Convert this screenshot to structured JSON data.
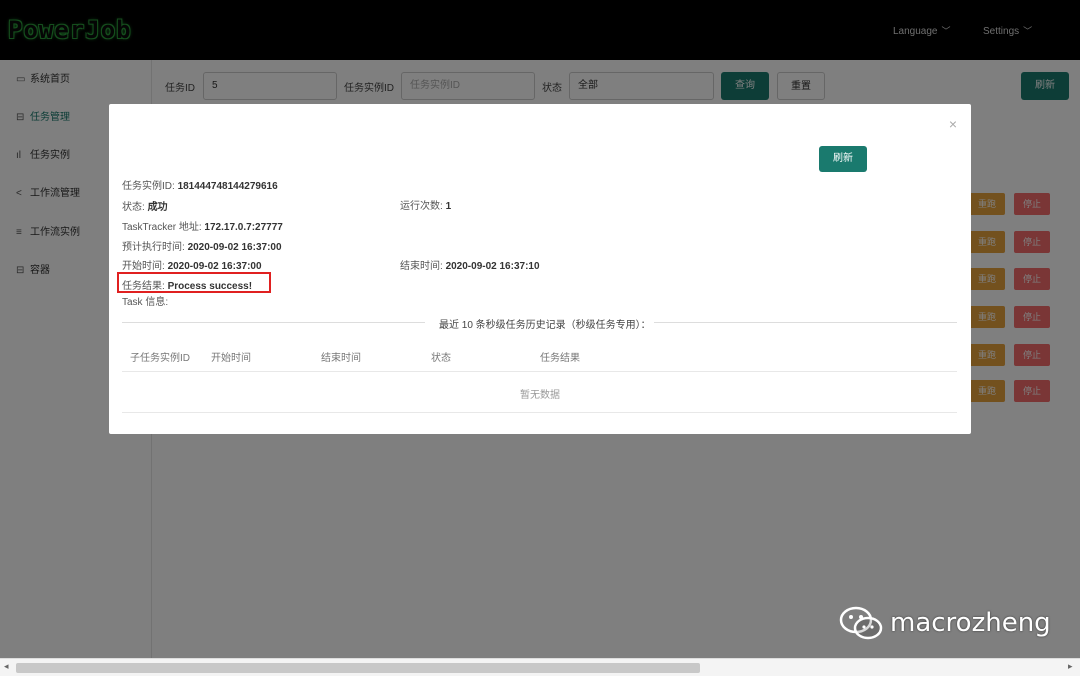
{
  "header": {
    "logo": "PowerJob",
    "language_label": "Language",
    "settings_label": "Settings"
  },
  "sidebar": {
    "items": [
      {
        "label": "系统首页",
        "icon": "monitor-icon"
      },
      {
        "label": "任务管理",
        "icon": "task-icon"
      },
      {
        "label": "任务实例",
        "icon": "bar-chart-icon"
      },
      {
        "label": "工作流管理",
        "icon": "share-icon"
      },
      {
        "label": "工作流实例",
        "icon": "sliders-icon"
      },
      {
        "label": "容器",
        "icon": "container-icon"
      }
    ],
    "active": "任务管理"
  },
  "filters": {
    "task_id_label": "任务ID",
    "task_id_value": "5",
    "instance_id_label": "任务实例ID",
    "instance_id_placeholder": "任务实例ID",
    "status_label": "状态",
    "status_value": "全部",
    "query_label": "查询",
    "reset_label": "重置",
    "refresh_label": "刷新"
  },
  "row_actions": {
    "retry_label": "重跑",
    "stop_label": "停止"
  },
  "modal": {
    "close": "×",
    "refresh_label": "刷新",
    "instance_id_label": "任务实例ID:",
    "instance_id_value": "181444748144279616",
    "status_label": "状态:",
    "status_value": "成功",
    "run_count_label": "运行次数:",
    "run_count_value": "1",
    "tracker_label": "TaskTracker 地址:",
    "tracker_value": "172.17.0.7:27777",
    "expected_time_label": "预计执行时间:",
    "expected_time_value": "2020-09-02 16:37:00",
    "start_time_label": "开始时间:",
    "start_time_value": "2020-09-02 16:37:00",
    "end_time_label": "结束时间:",
    "end_time_value": "2020-09-02 16:37:10",
    "result_label": "任务结果:",
    "result_value": "Process success!",
    "task_info_label": "Task 信息:",
    "history_title": "最近 10 条秒级任务历史记录（秒级任务专用）：",
    "columns": [
      "子任务实例ID",
      "开始时间",
      "结束时间",
      "状态",
      "任务结果"
    ],
    "empty_text": "暂无数据"
  },
  "watermark": "macrozheng",
  "colors": {
    "primary": "#1a7a6e",
    "warning": "#e6a23c",
    "danger": "#f56c6c",
    "highlight": "#e02020"
  }
}
